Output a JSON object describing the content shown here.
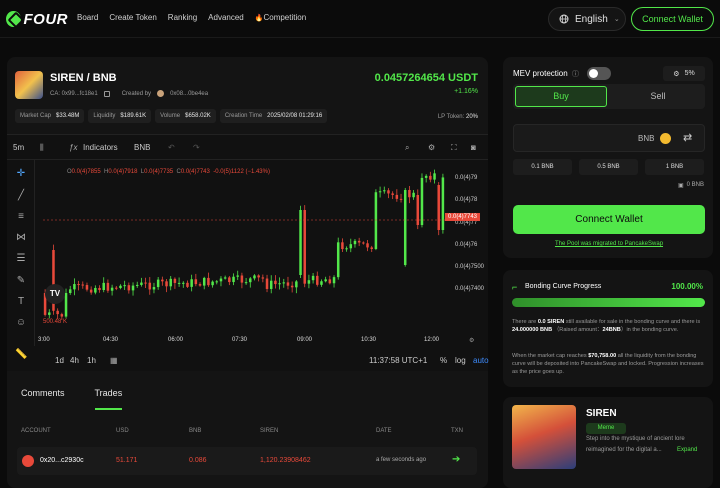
{
  "brand": {
    "name": "FOUR"
  },
  "nav": [
    "Board",
    "Create Token",
    "Ranking",
    "Advanced",
    "Competition"
  ],
  "competition_icon": "🔥",
  "lang": {
    "label": "English",
    "icon": "globe-icon"
  },
  "header_connect": "Connect Wallet",
  "token": {
    "pair": "SIREN / BNB",
    "ca": "CA: 0x99...fc18e1",
    "created_by_label": "Created by",
    "creator": "0x08...0be4ea",
    "price": "0.0457264654 USDT",
    "change": "+1.16%",
    "stats": [
      [
        "Market Cap",
        "$33.48M"
      ],
      [
        "Liquidity",
        "$189.61K"
      ],
      [
        "Volume",
        "$658.02K"
      ],
      [
        "Creation Time",
        "2025/02/08 01:29:16"
      ]
    ],
    "lp_label": "LP Token:",
    "lp_value": "20%"
  },
  "chart_toolbar": {
    "interval": "5m",
    "indicators": "Indicators",
    "quote": "BNB"
  },
  "ohlc": {
    "o_label": "O",
    "o": "0.0(4)7855",
    "h_label": "H",
    "h": "0.0(4)7918",
    "l_label": "L",
    "l": "0.0(4)7735",
    "c_label": "C",
    "c": "0.0(4)7743",
    "delta": "-0.0(5)1122 (−1.43%)"
  },
  "y_ticks": [
    "0.0(4)79",
    "0.0(4)78",
    "0.0(4)77",
    "0.0(4)76",
    "0.0(4)7500",
    "0.0(4)7400"
  ],
  "last_price_tag": "0.0(4)7743",
  "volume_label": "500.48 K",
  "time_ticks": [
    "3:00",
    "04:30",
    "06:00",
    "07:30",
    "09:00",
    "10:30",
    "12:00"
  ],
  "chart_bottom": {
    "ranges": [
      "1d",
      "4h",
      "1h"
    ],
    "clock": "11:37:58 UTC+1",
    "pct": "%",
    "log": "log",
    "auto": "auto"
  },
  "tabs": {
    "comments": "Comments",
    "trades": "Trades"
  },
  "trades_header": {
    "account": "ACCOUNT",
    "usd": "USD",
    "bnb": "BNB",
    "siren": "SIREN",
    "date": "DATE",
    "txn": "TXN"
  },
  "trade_row": {
    "account": "0x20...c2930c",
    "usd": "51.171",
    "bnb": "0.086",
    "siren": "1,120.23908462",
    "date": "a few seconds ago"
  },
  "swap": {
    "mev": "MEV protection",
    "slippage": "5%",
    "buy": "Buy",
    "sell": "Sell",
    "currency": "BNB",
    "quick": [
      "0.1 BNB",
      "0.5 BNB",
      "1 BNB"
    ],
    "balance": "0 BNB",
    "connect": "Connect Wallet",
    "migrated": "The Pool was migrated to PancakeSwap"
  },
  "bonding": {
    "title": "Bonding Curve Progress",
    "value": "100.00%",
    "progress": 1.0,
    "p1_a": "There are",
    "p1_b": "0.0 SIREN",
    "p1_c": "still available for sale in the bonding curve and there is",
    "p1_d": "24.000000 BNB",
    "p1_e": "（Raised amount：",
    "p1_f": "24BNB",
    "p1_g": "）in the bonding curve.",
    "p2_a": "When the market cap reaches",
    "p2_b": "$70,758.00",
    "p2_c": "all the liquidity from the bonding curve will be deposited into PancakeSwap and locked. Progression increases as the price goes up."
  },
  "token_card": {
    "name": "SIREN",
    "tag": "Meme",
    "desc1": "Step into the mystique of ancient lore",
    "desc2": "reimagined for the digital a...",
    "expand": "Expand"
  },
  "colors": {
    "accent": "#52e74a",
    "down": "#e8493a",
    "bg": "#0b0b0b",
    "panel": "#141414"
  }
}
